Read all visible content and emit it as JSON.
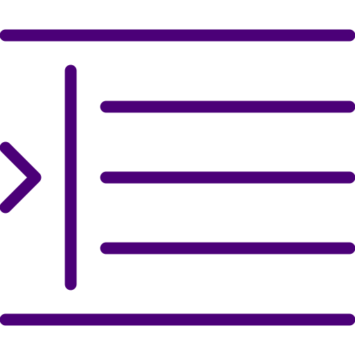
{
  "icon": {
    "name": "indent-increase-icon",
    "color": "#4b0078",
    "background": "#ffffff"
  }
}
